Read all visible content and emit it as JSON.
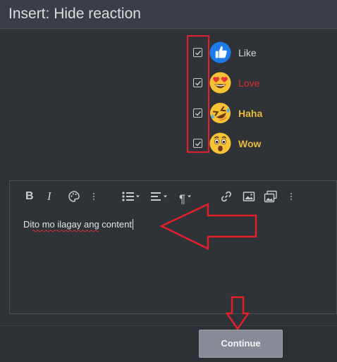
{
  "dialog": {
    "title": "Insert: Hide reaction"
  },
  "reactions": [
    {
      "label": "Like",
      "color": "#d4d6d9",
      "checked": true,
      "emoji": "thumbs-up"
    },
    {
      "label": "Love",
      "color": "#d92f2f",
      "checked": true,
      "emoji": "heart-eyes"
    },
    {
      "label": "Haha",
      "color": "#e9b93a",
      "checked": true,
      "emoji": "laughing"
    },
    {
      "label": "Wow",
      "color": "#e9b93a",
      "checked": true,
      "emoji": "surprised"
    }
  ],
  "toolbar": {
    "bold": "B",
    "italic": "I",
    "paragraph": "¶"
  },
  "editor": {
    "content": "Dito mo ilagay ang content"
  },
  "footer": {
    "continue_label": "Continue"
  },
  "colors": {
    "annotation": "#e0202a",
    "accent_button": "#868b95"
  }
}
